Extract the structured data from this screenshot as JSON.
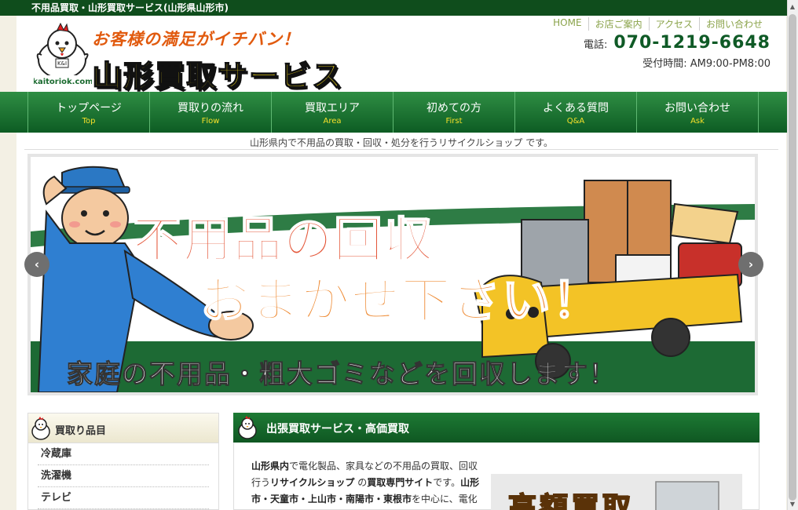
{
  "topbar": {
    "title": "不用品買取・山形買取サービス(山形県山形市)"
  },
  "header": {
    "catch": "お客様の満足がイチバン！",
    "brand": "山形買取サービス",
    "logo_text": "kaitoriok.com",
    "logo_badge": "K&I",
    "links": [
      "HOME",
      "お店ご案内",
      "アクセス",
      "お問い合わせ"
    ],
    "phone_label": "電話:",
    "phone": "070-1219-6648",
    "hours": "受付時間: AM9:00-PM8:00"
  },
  "nav": [
    {
      "jp": "トップページ",
      "en": "Top"
    },
    {
      "jp": "買取りの流れ",
      "en": "Flow"
    },
    {
      "jp": "買取エリア",
      "en": "Area"
    },
    {
      "jp": "初めての方",
      "en": "First"
    },
    {
      "jp": "よくある質問",
      "en": "Q&A"
    },
    {
      "jp": "お問い合わせ",
      "en": "Ask"
    }
  ],
  "tagline": "山形県内で不用品の買取・回収・処分を行うリサイクルショップ です。",
  "banner": {
    "line1": "不用品の回収",
    "line2": "おまかせ下さい！",
    "line3": "家庭の不用品・粗大ゴミなどを回収します！"
  },
  "sidebar": {
    "title": "買取り品目",
    "items": [
      "冷蔵庫",
      "洗濯機",
      "テレビ"
    ]
  },
  "main": {
    "title": "出張買取サービス・高価買取",
    "p1": "山形県内",
    "p2": "で電化製品、家具などの不用品の買取、回収行う",
    "p3": "リサイクルショップ",
    "p4": " の",
    "p5": "買取専門サイト",
    "p6": "です。",
    "p7": "山形市・天童市・上山市・南陽市・東根市",
    "p8": "を中心に、電化製品、家具などの不用品の回収、無",
    "promo": "高額買取"
  },
  "colors": {
    "green": "#0f5a26",
    "accent": "#f5e02a",
    "orange": "#e15a0e"
  }
}
